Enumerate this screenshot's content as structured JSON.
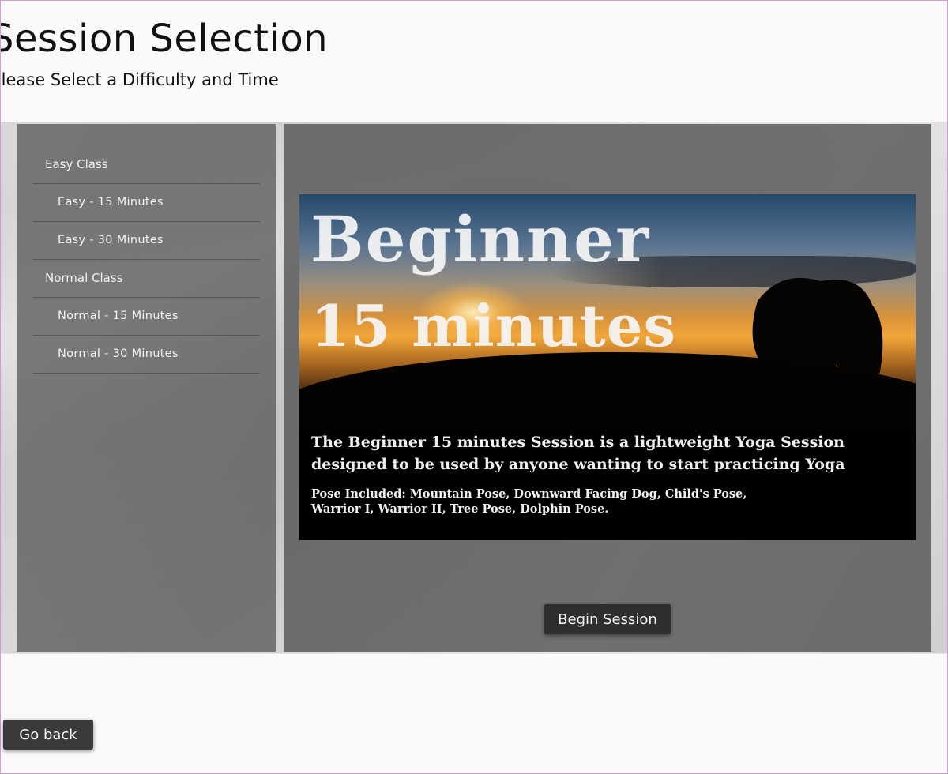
{
  "header": {
    "title": "Session Selection",
    "subtitle": "Please Select a Difficulty and Time"
  },
  "sidebar": {
    "items": [
      {
        "label": "Easy Class",
        "level": "group"
      },
      {
        "label": "Easy - 15 Minutes",
        "level": "sub"
      },
      {
        "label": "Easy - 30 Minutes",
        "level": "sub"
      },
      {
        "label": "Normal Class",
        "level": "group"
      },
      {
        "label": "Normal - 15 Minutes",
        "level": "sub"
      },
      {
        "label": "Normal - 30 Minutes",
        "level": "sub"
      }
    ]
  },
  "session": {
    "title_line1": "Beginner",
    "title_line2": "15 minutes",
    "description_line1": "The Beginner 15 minutes Session is a lightweight Yoga Session",
    "description_line2": "designed to be used by anyone wanting to start practicing Yoga",
    "poses_line1": "Pose Included: Mountain Pose, Downward Facing Dog, Child's Pose,",
    "poses_line2": "Warrior I, Warrior II, Tree Pose, Dolphin Pose.",
    "begin_label": "Begin Session"
  },
  "footer": {
    "back_label": "Go back"
  },
  "colors": {
    "panel": "#505050",
    "button": "#2e2e2e",
    "sunset": "#f2a73a"
  }
}
